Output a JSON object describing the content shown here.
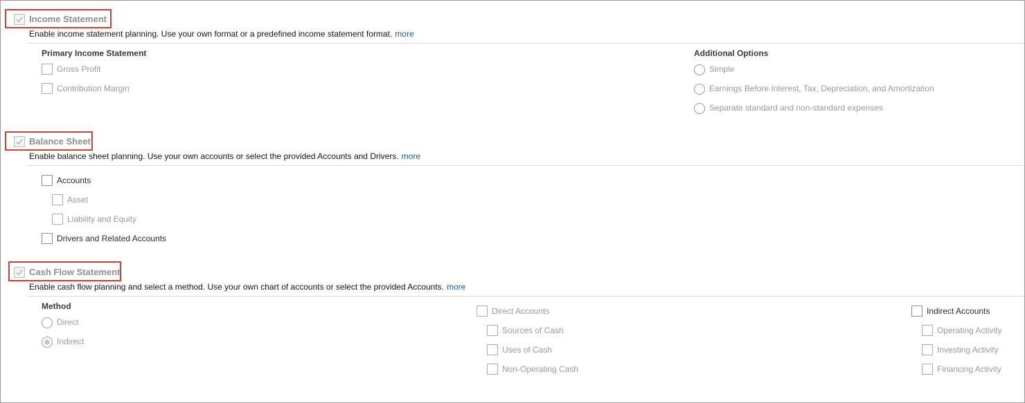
{
  "income_statement": {
    "title": "Income Statement",
    "description": "Enable income statement planning. Use your own format or a predefined income statement format.",
    "more": "more",
    "primary": {
      "title": "Primary Income Statement",
      "options": [
        "Gross Profit",
        "Contribution Margin"
      ]
    },
    "additional": {
      "title": "Additional Options",
      "options": [
        "Simple",
        "Earnings Before Interest, Tax, Depreciation, and Amortization",
        "Separate standard and non-standard expenses"
      ]
    }
  },
  "balance_sheet": {
    "title": "Balance Sheet",
    "description": "Enable balance sheet planning. Use your own accounts or select the provided Accounts and Drivers.",
    "more": "more",
    "accounts": "Accounts",
    "asset": "Asset",
    "liability_equity": "Liability and Equity",
    "drivers": "Drivers and Related Accounts"
  },
  "cash_flow": {
    "title": "Cash Flow Statement",
    "description": "Enable cash flow planning and select a method. Use your own chart of accounts or select the provided Accounts.",
    "more": "more",
    "method": {
      "title": "Method",
      "direct": "Direct",
      "indirect": "Indirect",
      "selected": "Indirect"
    },
    "direct_accounts": {
      "label": "Direct Accounts",
      "children": [
        "Sources of Cash",
        "Uses of Cash",
        "Non-Operating Cash"
      ]
    },
    "indirect_accounts": {
      "label": "Indirect Accounts",
      "children": [
        "Operating Activity",
        "Investing Activity",
        "Financing Activity"
      ]
    }
  },
  "colors": {
    "highlight": "#c74634",
    "link": "#1a5e98",
    "disabled_text": "#9a9a9a"
  }
}
